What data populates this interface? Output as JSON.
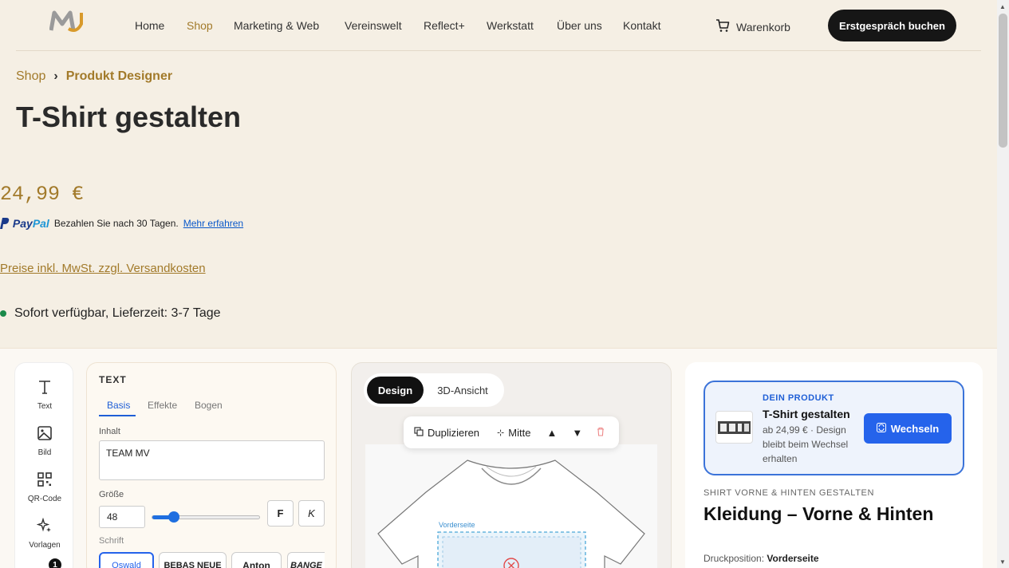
{
  "nav": {
    "items": [
      "Home",
      "Shop",
      "Marketing & Web",
      "Vereinswelt",
      "Reflect+",
      "Werkstatt",
      "Über uns",
      "Kontakt"
    ],
    "active": "Shop",
    "cart_label": "Warenkorb",
    "cta_label": "Erstgespräch buchen"
  },
  "breadcrumb": {
    "parent": "Shop",
    "separator": "›",
    "current": "Produkt Designer"
  },
  "product": {
    "title": "T-Shirt gestalten",
    "price": "24,99 €",
    "paypal_text": "Bezahlen Sie nach 30 Tagen.",
    "paypal_link": "Mehr erfahren",
    "tax_note": "Preise inkl. MwSt. zzgl. Versandkosten",
    "availability": "Sofort verfügbar, Lieferzeit: 3-7 Tage"
  },
  "tools": [
    {
      "label": "Text",
      "icon": "text-icon"
    },
    {
      "label": "Bild",
      "icon": "image-icon"
    },
    {
      "label": "QR-Code",
      "icon": "qr-code-icon"
    },
    {
      "label": "Vorlagen",
      "icon": "sparkle-icon"
    }
  ],
  "tool_badge": "1",
  "text_panel": {
    "title": "TEXT",
    "tabs": [
      "Basis",
      "Effekte",
      "Bogen"
    ],
    "active_tab": "Basis",
    "content_label": "Inhalt",
    "content_value": "TEAM MV",
    "size_label": "Größe",
    "size_value": "48",
    "size_slider_fraction": 0.2,
    "bold_label": "F",
    "italic_label": "K",
    "font_label": "Schrift",
    "fonts": [
      "Oswald",
      "BEBAS NEUE",
      "Anton",
      "BANGE"
    ]
  },
  "canvas": {
    "view_design": "Design",
    "view_3d": "3D-Ansicht",
    "duplicate_label": "Duplizieren",
    "center_label": "Mitte",
    "print_area_label": "Vorderseite"
  },
  "right": {
    "your_product_label": "DEIN PRODUKT",
    "product_name": "T-Shirt gestalten",
    "product_desc": "ab 24,99 € · Design bleibt beim Wechsel erhalten",
    "switch_label": "Wechseln",
    "kicker": "SHIRT VORNE & HINTEN GESTALTEN",
    "heading": "Kleidung – Vorne & Hinten",
    "print_pos_label": "Druckposition:",
    "print_pos_value": "Vorderseite"
  },
  "colors": {
    "accent": "#a27a2a",
    "primary_blue": "#2563eb",
    "dark": "#161616",
    "page_bg": "#f5efe4"
  }
}
